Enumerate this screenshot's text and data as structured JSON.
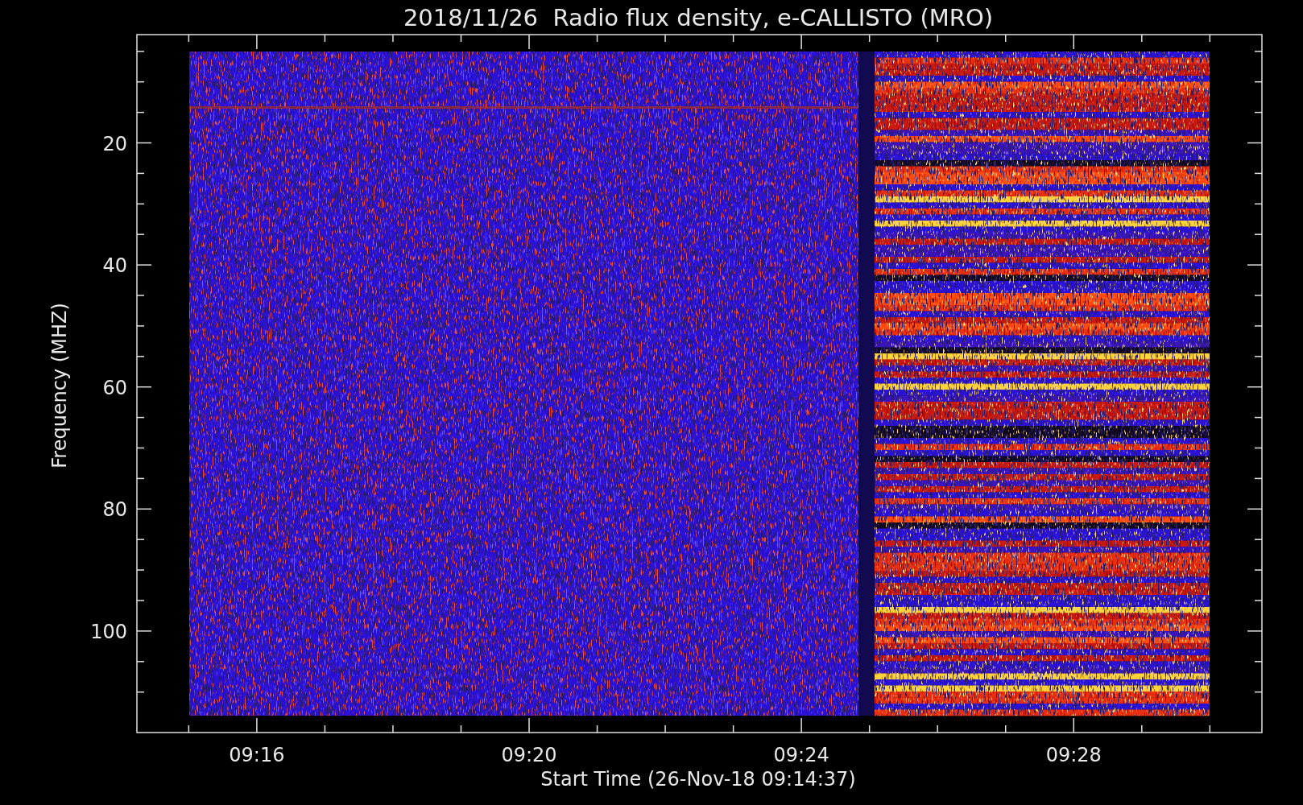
{
  "title": "2018/11/26  Radio flux density, e-CALLISTO (MRO)",
  "y_axis": {
    "label": "Frequency (MHZ)",
    "ticks": [
      "20",
      "40",
      "60",
      "80",
      "100"
    ]
  },
  "x_axis": {
    "label": "Start Time (26-Nov-18 09:14:37)",
    "ticks": [
      "09:16",
      "09:20",
      "09:24",
      "09:28"
    ]
  }
}
